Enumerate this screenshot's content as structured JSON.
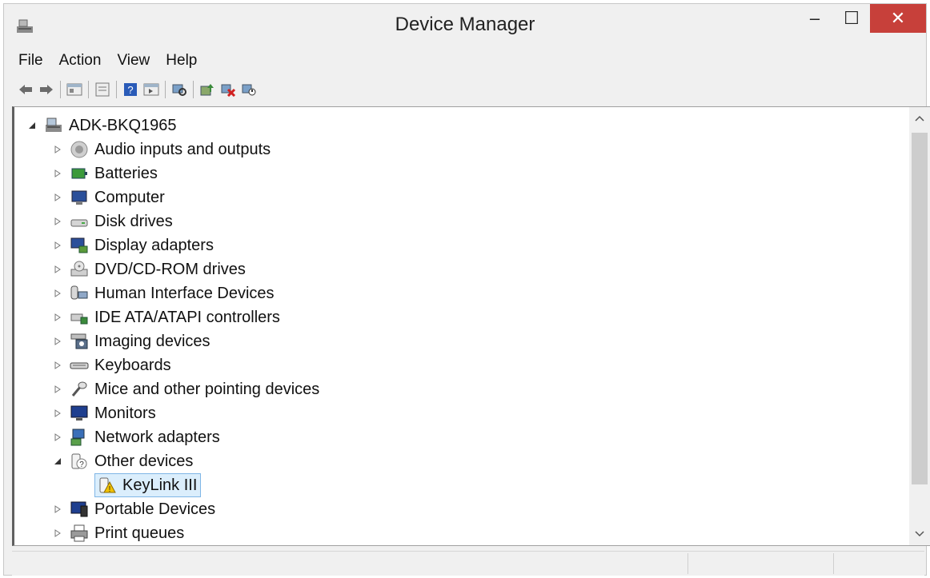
{
  "window": {
    "title": "Device Manager",
    "minimize": "–",
    "maximize": "☐",
    "close": "✕"
  },
  "menu": [
    "File",
    "Action",
    "View",
    "Help"
  ],
  "toolbar": [
    "back-icon",
    "forward-icon",
    "properties-sheet-icon",
    "details-icon",
    "help-icon",
    "view-icon",
    "scan-hardware-icon",
    "update-driver-icon",
    "uninstall-icon",
    "enable-device-icon"
  ],
  "tree": {
    "root": {
      "label": "ADK-BKQ1965",
      "icon": "computer-icon"
    },
    "categories": [
      {
        "label": "Audio inputs and outputs",
        "icon": "speaker-icon"
      },
      {
        "label": "Batteries",
        "icon": "battery-icon"
      },
      {
        "label": "Computer",
        "icon": "computer-monitor-icon"
      },
      {
        "label": "Disk drives",
        "icon": "disk-drive-icon"
      },
      {
        "label": "Display adapters",
        "icon": "display-adapter-icon"
      },
      {
        "label": "DVD/CD-ROM drives",
        "icon": "dvd-drive-icon"
      },
      {
        "label": "Human Interface Devices",
        "icon": "hid-icon"
      },
      {
        "label": "IDE ATA/ATAPI controllers",
        "icon": "ide-controller-icon"
      },
      {
        "label": "Imaging devices",
        "icon": "camera-icon"
      },
      {
        "label": "Keyboards",
        "icon": "keyboard-icon"
      },
      {
        "label": "Mice and other pointing devices",
        "icon": "mouse-icon"
      },
      {
        "label": "Monitors",
        "icon": "monitor-icon"
      },
      {
        "label": "Network adapters",
        "icon": "network-adapter-icon"
      },
      {
        "label": "Other devices",
        "icon": "unknown-device-icon",
        "expanded": true
      },
      {
        "label": "KeyLink III",
        "icon": "warning-device-icon",
        "child": true,
        "selected": true
      },
      {
        "label": "Portable Devices",
        "icon": "portable-device-icon"
      },
      {
        "label": "Print queues",
        "icon": "printer-icon"
      }
    ]
  }
}
